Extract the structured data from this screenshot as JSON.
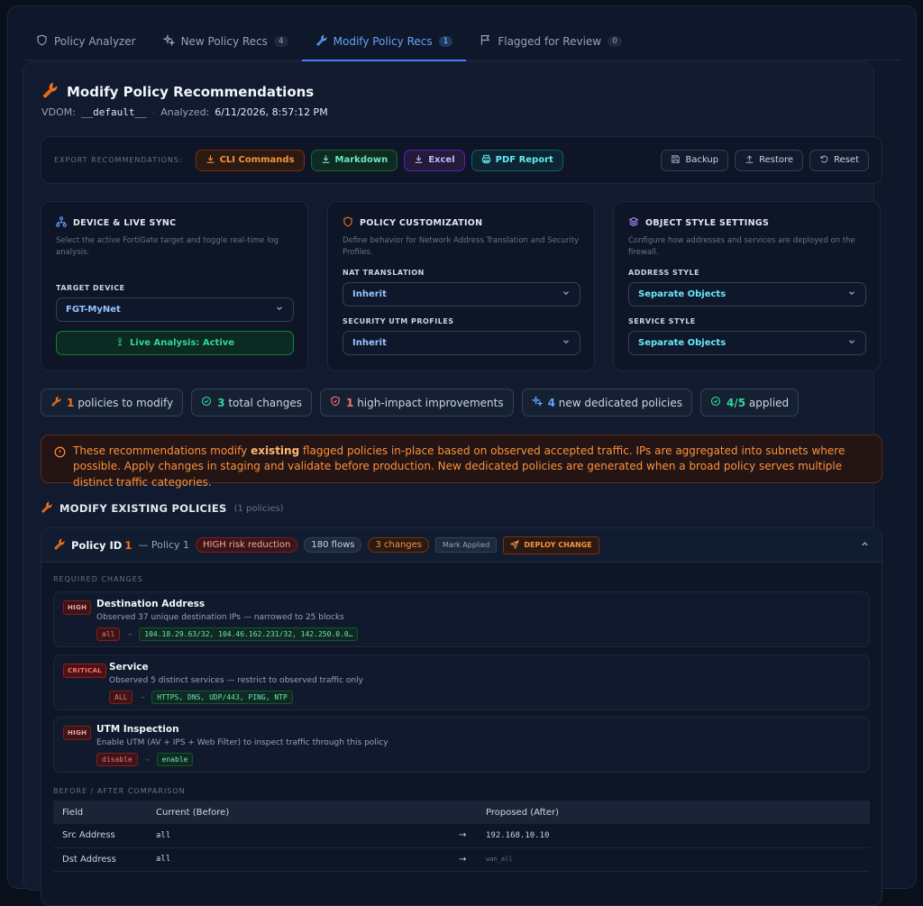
{
  "tabs": [
    {
      "label": "Policy Analyzer",
      "badge": ""
    },
    {
      "label": "New Policy Recs",
      "badge": "4"
    },
    {
      "label": "Modify Policy Recs",
      "badge": "1"
    },
    {
      "label": "Flagged for Review",
      "badge": "0"
    }
  ],
  "header": {
    "title": "Modify Policy Recommendations",
    "vdom_label": "VDOM:",
    "vdom_value": "__default__",
    "analyzed_label": "Analyzed:",
    "analyzed_value": "6/11/2026, 8:57:12 PM"
  },
  "export": {
    "label": "EXPORT RECOMMENDATIONS:",
    "cli": "CLI Commands",
    "markdown": "Markdown",
    "excel": "Excel",
    "pdf": "PDF Report",
    "backup": "Backup",
    "restore": "Restore",
    "reset": "Reset"
  },
  "panels": {
    "device": {
      "title": "DEVICE & LIVE SYNC",
      "desc": "Select the active FortiGate target and toggle real-time log analysis.",
      "target_label": "TARGET DEVICE",
      "target_value": "FGT-MyNet",
      "live_button": "Live Analysis: Active"
    },
    "policy": {
      "title": "POLICY CUSTOMIZATION",
      "desc": "Define behavior for Network Address Translation and Security Profiles.",
      "nat_label": "NAT TRANSLATION",
      "nat_value": "Inherit",
      "utm_label": "SECURITY UTM PROFILES",
      "utm_value": "Inherit"
    },
    "object": {
      "title": "OBJECT STYLE SETTINGS",
      "desc": "Configure how addresses and services are deployed on the firewall.",
      "address_label": "ADDRESS STYLE",
      "address_value": "Separate Objects",
      "service_label": "SERVICE STYLE",
      "service_value": "Separate Objects"
    }
  },
  "stats": [
    {
      "num": "1",
      "text": "policies to modify",
      "color": "#f97316"
    },
    {
      "num": "3",
      "text": "total changes",
      "color": "#34d399"
    },
    {
      "num": "1",
      "text": "high-impact improvements",
      "color": "#f87171"
    },
    {
      "num": "4",
      "text": "new dedicated policies",
      "color": "#60a5fa"
    },
    {
      "num": "4/5",
      "text": "applied",
      "color": "#34d399"
    }
  ],
  "alert": {
    "pre": "These recommendations modify ",
    "bold": "existing",
    "post": " flagged policies in-place based on observed accepted traffic. IPs are aggregated into subnets where possible. Apply changes in staging and validate before production. New dedicated policies are generated when a broad policy serves multiple distinct traffic categories."
  },
  "section": {
    "title": "MODIFY EXISTING POLICIES",
    "sub": "(1 policies)"
  },
  "policy": {
    "id_label": "Policy ID",
    "id": "1",
    "name": "— Policy 1",
    "risk": "HIGH risk reduction",
    "flows": "180 flows",
    "changes": "3 changes",
    "mark_applied": "Mark Applied",
    "deploy": "DEPLOY CHANGE",
    "required_label": "REQUIRED CHANGES",
    "items": [
      {
        "severity": "HIGH",
        "title": "Destination Address",
        "desc": "Observed 37 unique destination IPs — narrowed to 25 blocks",
        "old": "all",
        "new": "104.18.29.63/32, 104.46.162.231/32, 142.250.0.0…"
      },
      {
        "severity": "CRITICAL",
        "title": "Service",
        "desc": "Observed 5 distinct services — restrict to observed traffic only",
        "old": "ALL",
        "new": "HTTPS, DNS, UDP/443, PING, NTP"
      },
      {
        "severity": "HIGH",
        "title": "UTM Inspection",
        "desc": "Enable UTM (AV + IPS + Web Filter) to inspect traffic through this policy",
        "old": "disable",
        "new": "enable"
      }
    ],
    "comparison_label": "BEFORE / AFTER COMPARISON",
    "comparison": {
      "headers": [
        "Field",
        "Current (Before)",
        "",
        "Proposed (After)"
      ],
      "rows": [
        {
          "field": "Src Address",
          "before": "all",
          "after": "192.168.10.10"
        },
        {
          "field": "Dst Address",
          "before": "all",
          "after": "wan_all"
        }
      ]
    }
  }
}
